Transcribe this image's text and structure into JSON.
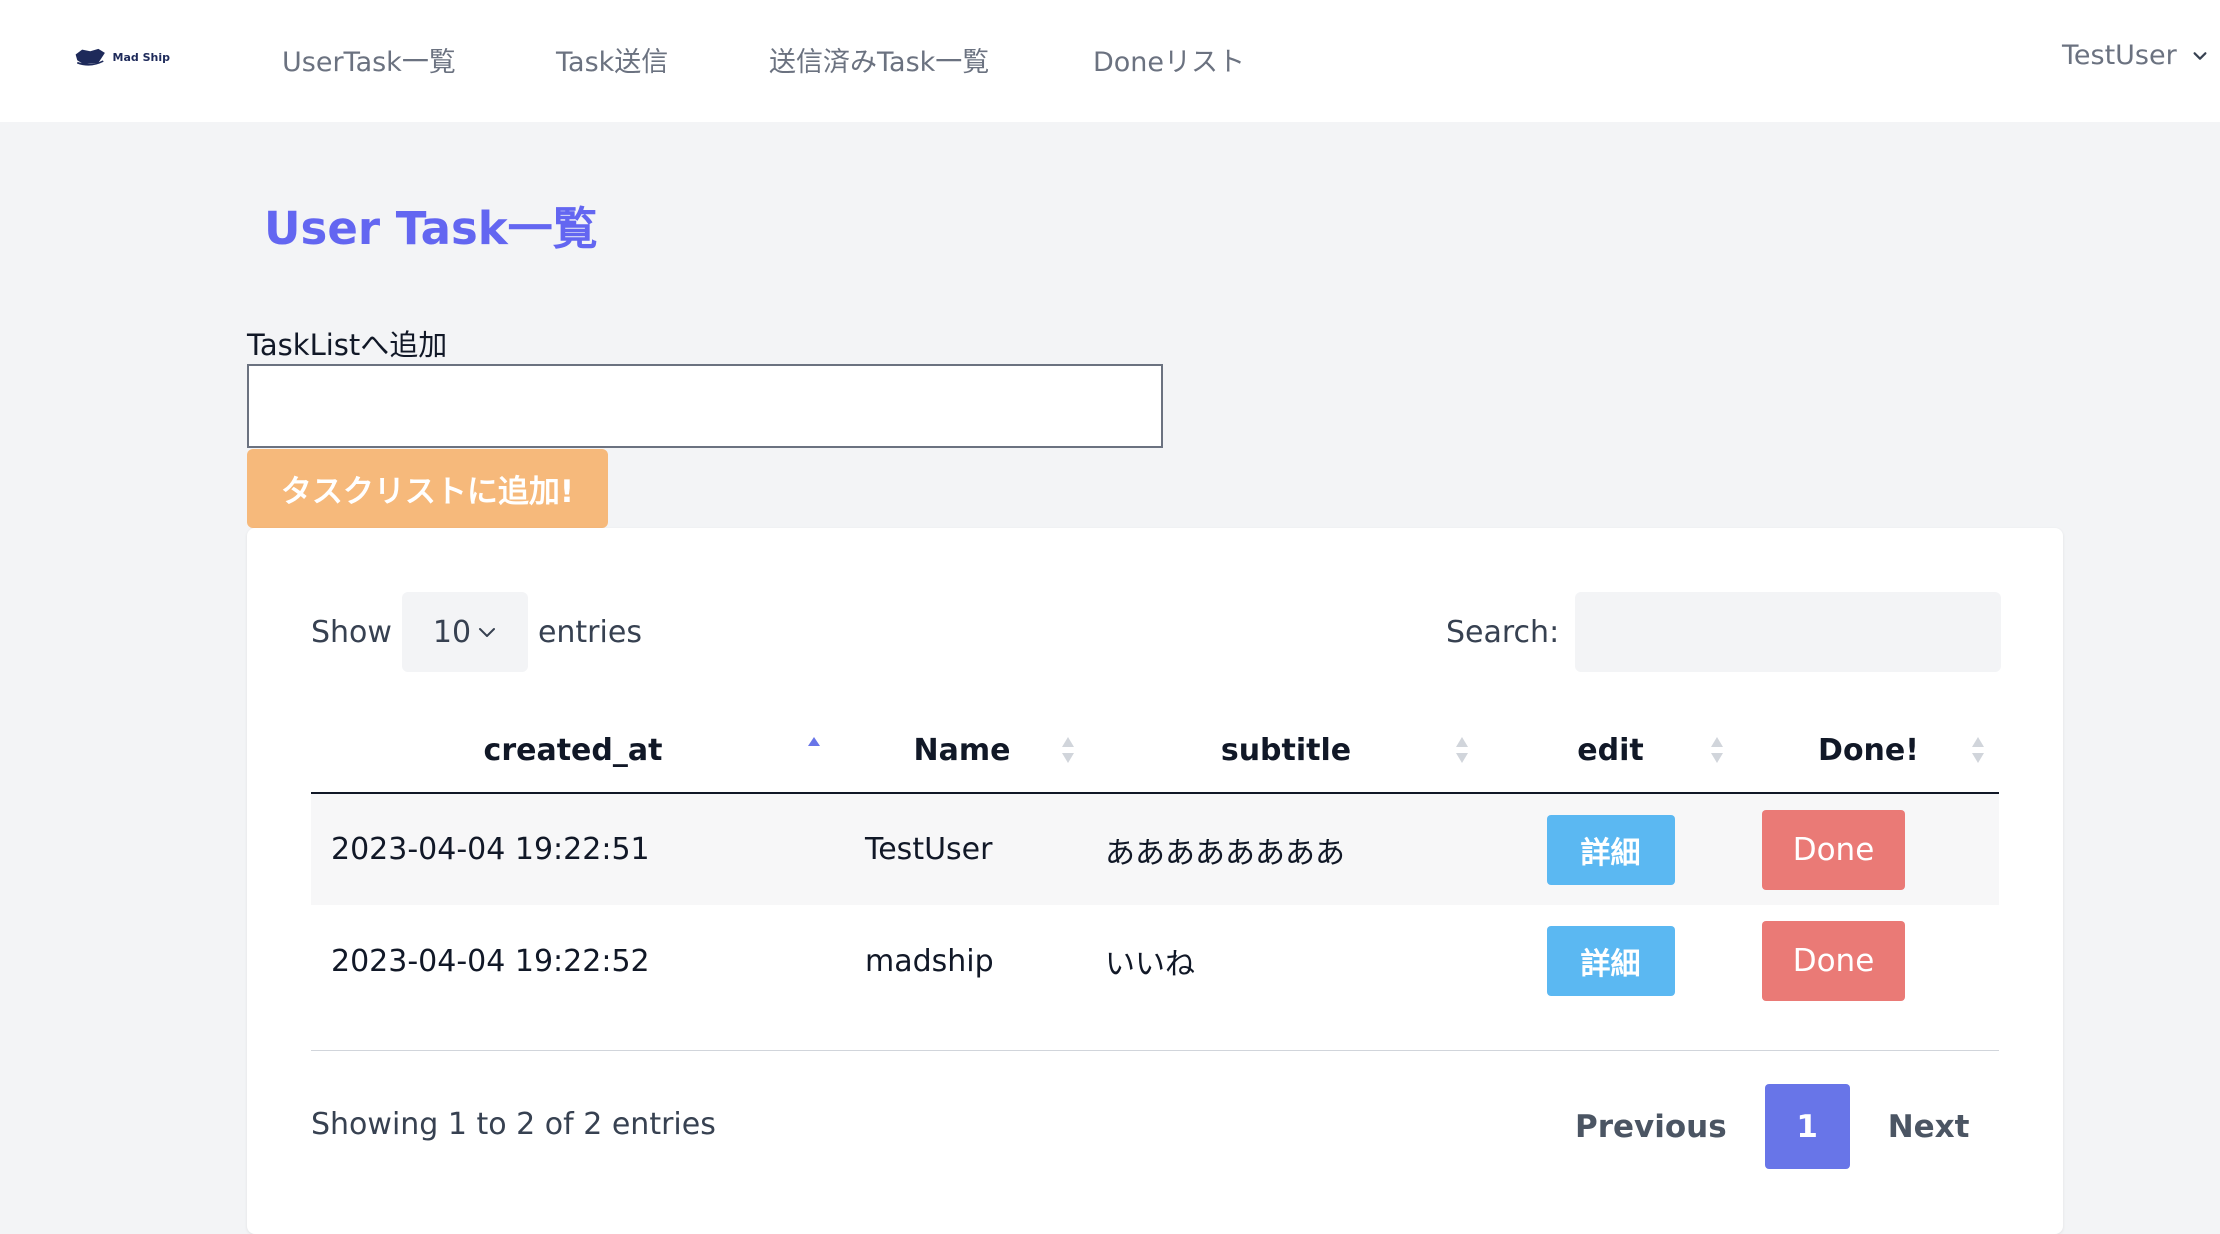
{
  "nav": {
    "logo_text": "Mad Ship",
    "links": [
      "UserTask一覧",
      "Task送信",
      "送信済みTask一覧",
      "Doneリスト"
    ],
    "user": "TestUser"
  },
  "page": {
    "title": "User Task一覧",
    "add_label": "TaskListへ追加",
    "add_input_value": "",
    "add_button": "タスクリストに追加!"
  },
  "table_controls": {
    "show_label": "Show",
    "length_value": "10",
    "entries_label": "entries",
    "search_label": "Search:",
    "search_value": ""
  },
  "table": {
    "headers": [
      "created_at",
      "Name",
      "subtitle",
      "edit",
      "Done!"
    ],
    "sorted_column": "created_at",
    "sort_direction": "ascending",
    "rows": [
      {
        "created_at": "2023-04-04 19:22:51",
        "name": "TestUser",
        "subtitle": "ああああああああ",
        "edit": "詳細",
        "done": "Done"
      },
      {
        "created_at": "2023-04-04 19:22:52",
        "name": "madship",
        "subtitle": "いいね",
        "edit": "詳細",
        "done": "Done"
      }
    ]
  },
  "footer": {
    "info": "Showing 1 to 2 of 2 entries",
    "previous": "Previous",
    "current_page": "1",
    "next": "Next"
  },
  "colors": {
    "accent": "#6366f1",
    "add_button": "#f6b97b",
    "detail_button": "#5bb8f2",
    "done_button": "#ea7a76",
    "page_current": "#6875e8"
  }
}
